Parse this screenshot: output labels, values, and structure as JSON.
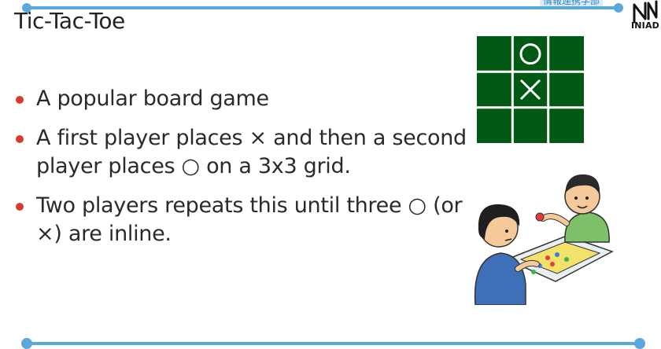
{
  "slide": {
    "title": "Tic-Tac-Toe",
    "header_tag": "情報連携学部",
    "logo_text": "INIAD",
    "bullets": [
      "A popular board game",
      "A first player places × and then a second player places ○ on a 3x3 grid.",
      "Two players repeats this until three ○ (or ×) are inline."
    ]
  },
  "board": {
    "cells": [
      "",
      "○",
      "",
      "",
      "×",
      "",
      "",
      "",
      ""
    ],
    "background_color": "#005a13",
    "line_color": "#ffffff"
  },
  "colors": {
    "accent": "#5aa9dd",
    "bullet": "#d93a2f",
    "text": "#2a2a2a"
  }
}
